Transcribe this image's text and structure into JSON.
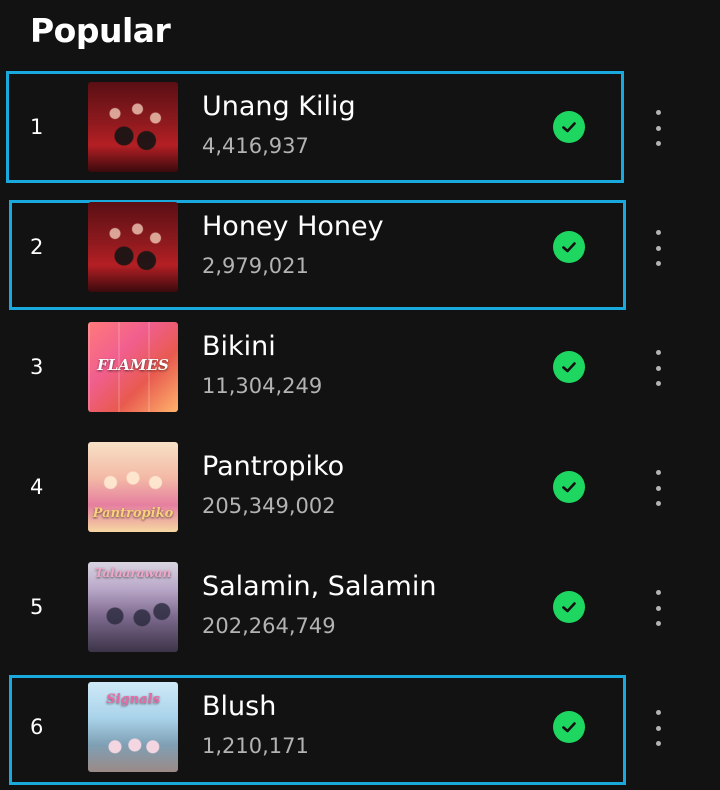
{
  "section": {
    "title": "Popular"
  },
  "colors": {
    "background": "#121212",
    "check": "#1ed760",
    "highlight": "#1aa9dc",
    "subtext": "#b3b3b3"
  },
  "tracks": [
    {
      "rank": "1",
      "title": "Unang Kilig",
      "plays": "4,416,937",
      "art_icon": "album-art-unang-kilig",
      "status_icon": "downloaded-check-icon",
      "more_icon": "more-options-icon"
    },
    {
      "rank": "2",
      "title": "Honey Honey",
      "plays": "2,979,021",
      "art_icon": "album-art-honey-honey",
      "status_icon": "downloaded-check-icon",
      "more_icon": "more-options-icon"
    },
    {
      "rank": "3",
      "title": "Bikini",
      "plays": "11,304,249",
      "art_icon": "album-art-flames",
      "art_text": "FLAMES",
      "status_icon": "downloaded-check-icon",
      "more_icon": "more-options-icon"
    },
    {
      "rank": "4",
      "title": "Pantropiko",
      "plays": "205,349,002",
      "art_icon": "album-art-pantropiko",
      "art_text": "Pantropiko",
      "status_icon": "downloaded-check-icon",
      "more_icon": "more-options-icon"
    },
    {
      "rank": "5",
      "title": "Salamin, Salamin",
      "plays": "202,264,749",
      "art_icon": "album-art-salamin",
      "art_text": "Talaarawan",
      "status_icon": "downloaded-check-icon",
      "more_icon": "more-options-icon"
    },
    {
      "rank": "6",
      "title": "Blush",
      "plays": "1,210,171",
      "art_icon": "album-art-blush",
      "art_text": "Signals",
      "status_icon": "downloaded-check-icon",
      "more_icon": "more-options-icon"
    }
  ]
}
